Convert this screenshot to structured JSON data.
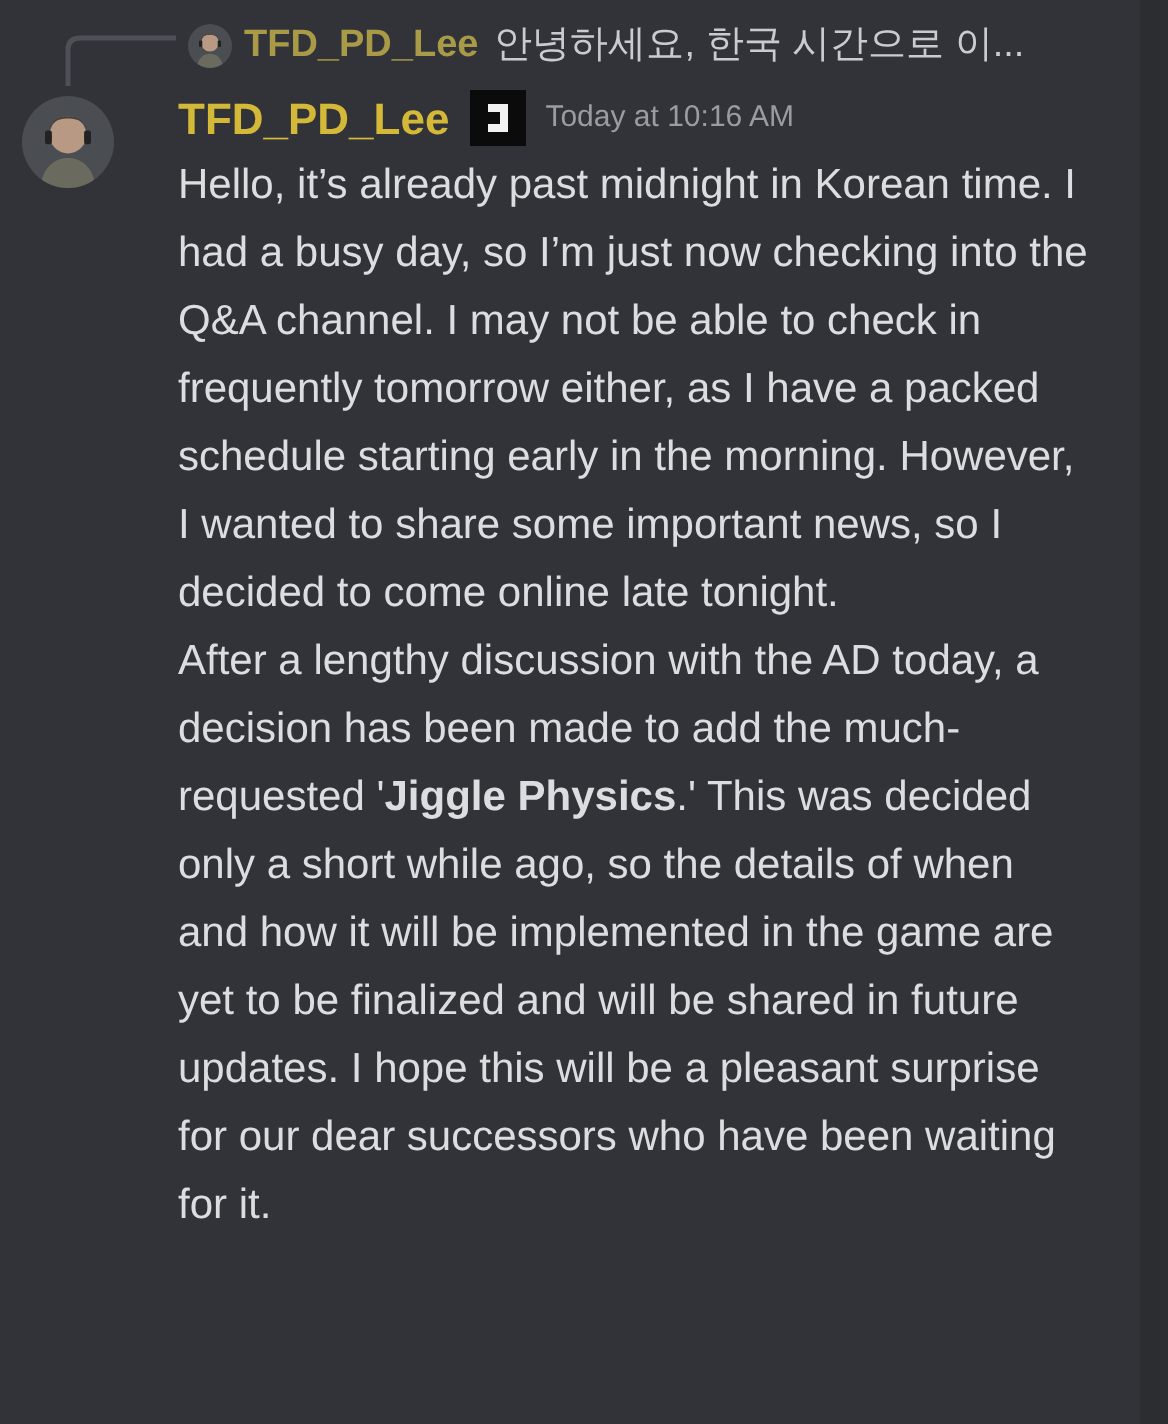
{
  "reply": {
    "author": "TFD_PD_Lee",
    "preview": "안녕하세요, 한국 시간으로 이..."
  },
  "message": {
    "author": "TFD_PD_Lee",
    "timestamp": "Today at 10:16 AM",
    "paragraphs": [
      "Hello, it’s already past midnight in Korean time. I had a busy day, so I’m just now checking into the Q&A channel. I may not be able to check in frequently tomorrow either, as I have a packed schedule starting early in the morning. However, I wanted to share some important news, so I decided to come online late tonight.",
      "After a lengthy discussion with the AD today, a decision has been made to add the much-requested '**Jiggle Physics**.' This was decided only a short while ago, so the details of when and how it will be implemented in the game are yet to be finalized and will be shared in future updates. I hope this will be a pleasant surprise for our dear successors who have been waiting for it."
    ]
  }
}
